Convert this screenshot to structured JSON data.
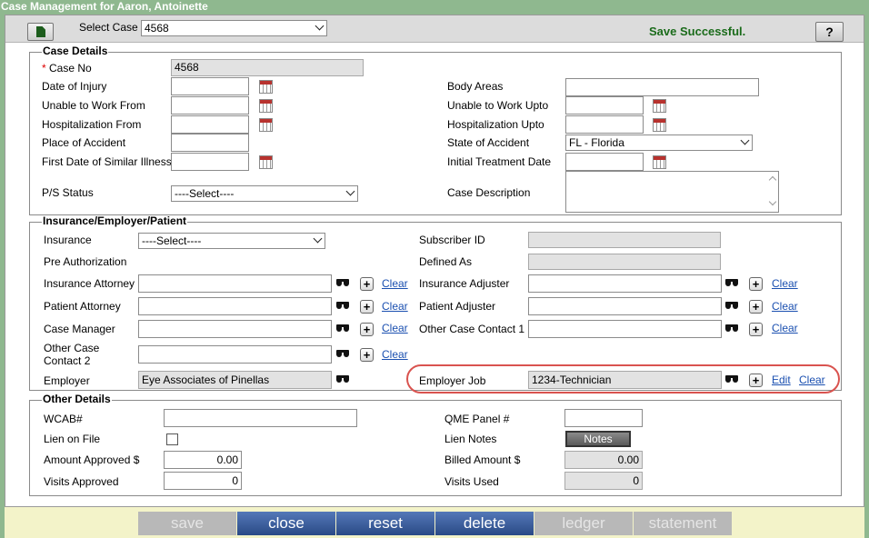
{
  "window": {
    "title": "Case Management for Aaron, Antoinette"
  },
  "toolbar": {
    "select_case_label": "Select Case",
    "select_case_value": "4568",
    "save_message": "Save Successful.",
    "help_label": "?"
  },
  "case_details": {
    "legend": "Case Details",
    "required_mark": "*",
    "case_no_label": "Case No",
    "case_no_value": "4568",
    "date_of_injury_label": "Date of Injury",
    "unable_from_label": "Unable to Work From",
    "hosp_from_label": "Hospitalization From",
    "place_label": "Place of Accident",
    "first_date_label": "First Date of Similar Illness",
    "ps_status_label": "P/S Status",
    "ps_status_value": "----Select----",
    "body_areas_label": "Body Areas",
    "unable_upto_label": "Unable to Work Upto",
    "hosp_upto_label": "Hospitalization Upto",
    "state_label": "State of Accident",
    "state_value": "FL - Florida",
    "initial_treatment_label": "Initial Treatment Date",
    "case_desc_label": "Case Description"
  },
  "insurance": {
    "legend": "Insurance/Employer/Patient",
    "insurance_label": "Insurance",
    "insurance_value": "----Select----",
    "pre_auth_label": "Pre Authorization",
    "ins_attorney_label": "Insurance Attorney",
    "patient_attorney_label": "Patient Attorney",
    "case_manager_label": "Case Manager",
    "other_contact2_label_1": "Other Case",
    "other_contact2_label_2": "Contact 2",
    "employer_label": "Employer",
    "employer_value": "Eye Associates of Pinellas",
    "subscriber_label": "Subscriber ID",
    "defined_as_label": "Defined As",
    "ins_adjuster_label": "Insurance Adjuster",
    "patient_adjuster_label": "Patient Adjuster",
    "other_contact1_label": "Other Case Contact 1",
    "employer_job_label": "Employer Job",
    "employer_job_value": "1234-Technician",
    "clear_label": "Clear",
    "edit_label": "Edit"
  },
  "other_details": {
    "legend": "Other Details",
    "wcab_label": "WCAB#",
    "lien_on_file_label": "Lien on File",
    "amount_approved_label": "Amount Approved $",
    "amount_approved_value": "0.00",
    "visits_approved_label": "Visits Approved",
    "visits_approved_value": "0",
    "qme_label": "QME Panel #",
    "lien_notes_label": "Lien Notes",
    "notes_button": "Notes",
    "billed_amount_label": "Billed Amount $",
    "billed_amount_value": "0.00",
    "visits_used_label": "Visits Used",
    "visits_used_value": "0"
  },
  "actions": {
    "save": "save",
    "close": "close",
    "reset": "reset",
    "delete": "delete",
    "ledger": "ledger",
    "statement": "statement"
  },
  "colors": {
    "title_bar": "#8fb88f",
    "success_text": "#1a6b1a",
    "link": "#1a4fb0",
    "highlight": "#d9534f",
    "action_button": "#2a4a86"
  }
}
